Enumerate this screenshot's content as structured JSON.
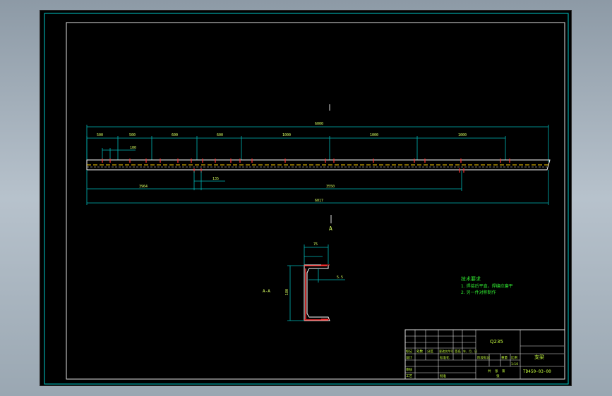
{
  "app": {
    "viewport_bg": "#000000",
    "frame_color": "#00c8c8"
  },
  "colors": {
    "dim": "#00b8b8",
    "outline": "#ffffff",
    "hatch": "#ff3030",
    "center": "#ffd200",
    "text": "#d8ff60",
    "notes": "#30e830",
    "title_text": "#c8ff40"
  },
  "drawing": {
    "section_marker": "A",
    "section_label": "A-A",
    "main_dims": {
      "overall_top": "6000",
      "overall_bottom": "6017",
      "segments": [
        "500",
        "500",
        "600",
        "600",
        "1000",
        "1000",
        "1000"
      ],
      "hole_pitch": "100",
      "lower_left": "3964",
      "lower_right": "3550",
      "hole_gap": "135"
    },
    "section_dims": {
      "width": "75",
      "height": "180",
      "thickness": "5.5"
    }
  },
  "notes": {
    "title": "技术要求",
    "items": [
      "1. 焊接后平直，焊缝应磨平",
      "2. 另一件对称制作"
    ]
  },
  "title_block": {
    "material": "Q235",
    "part_name": "支梁",
    "drawing_no": "TD450-03-00",
    "scale": "1:10",
    "row_labels": [
      "标记",
      "处数",
      "分区",
      "更改文件号",
      "签名",
      "年、月、日"
    ],
    "approve_labels": [
      "设计",
      "标准化",
      "审核",
      "工艺",
      "批准"
    ],
    "stage_label": "阶段标记",
    "weight_label": "重量",
    "scale_label": "比例",
    "sheet_labels": [
      "共",
      "张",
      "第",
      "张"
    ]
  }
}
